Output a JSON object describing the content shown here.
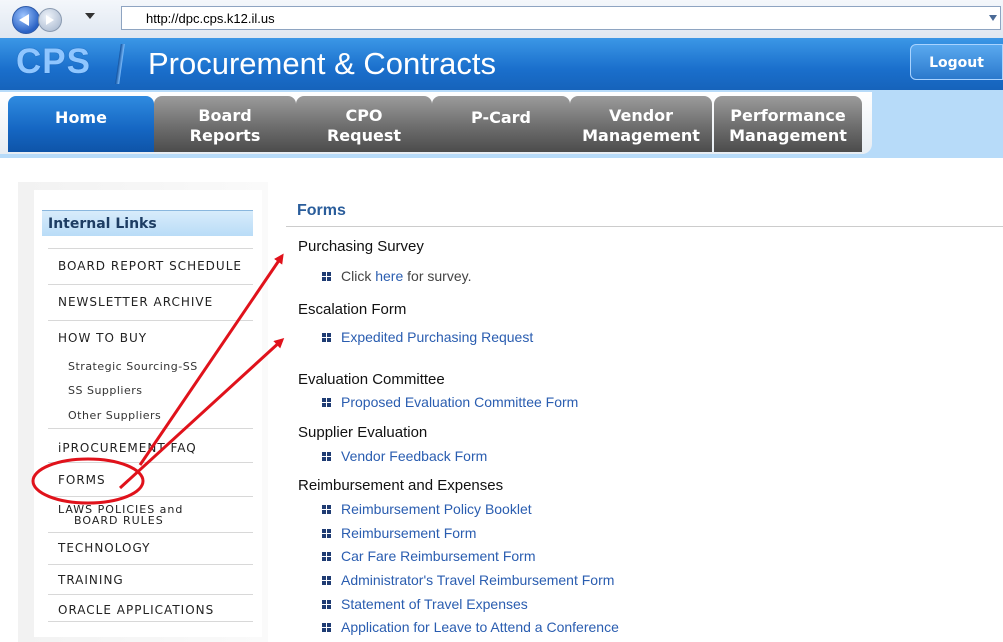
{
  "browser": {
    "url": "http://dpc.cps.k12.il.us"
  },
  "header": {
    "logo": "CPS",
    "title": "Procurement & Contracts",
    "logout_label": "Logout",
    "accent": "#1a6fcc"
  },
  "tabs": [
    {
      "line1": "Home",
      "line2": ""
    },
    {
      "line1": "Board",
      "line2": "Reports"
    },
    {
      "line1": "CPO",
      "line2": "Request"
    },
    {
      "line1": "P-Card",
      "line2": ""
    },
    {
      "line1": "Vendor",
      "line2": "Management"
    },
    {
      "line1": "Performance",
      "line2": "Management"
    }
  ],
  "sidebar": {
    "heading": "Internal Links",
    "items": [
      "BOARD REPORT SCHEDULE",
      "NEWSLETTER ARCHIVE",
      "HOW TO BUY",
      "iPROCUREMENT FAQ",
      "FORMS",
      "LAWS POLICIES and",
      "BOARD RULES",
      "TECHNOLOGY",
      "TRAINING",
      "ORACLE APPLICATIONS"
    ],
    "subitems": [
      "Strategic Sourcing-SS",
      "SS Suppliers",
      "Other Suppliers"
    ]
  },
  "content": {
    "title": "Forms",
    "sections": {
      "purchasing_survey": {
        "title": "Purchasing Survey",
        "prefix": "Click",
        "link": "here",
        "suffix": "for survey."
      },
      "escalation": {
        "title": "Escalation Form",
        "links": [
          "Expedited Purchasing Request"
        ]
      },
      "evaluation_committee": {
        "title": "Evaluation Committee",
        "links": [
          "Proposed Evaluation Committee Form"
        ]
      },
      "supplier_evaluation": {
        "title": "Supplier Evaluation",
        "links": [
          "Vendor Feedback Form"
        ]
      },
      "reimbursement": {
        "title": "Reimbursement and Expenses",
        "links": [
          "Reimbursement Policy Booklet",
          "Reimbursement Form",
          "Car Fare Reimbursement Form",
          "Administrator's Travel Reimbursement Form",
          "Statement of Travel Expenses",
          "Application for Leave to Attend a Conference"
        ]
      }
    }
  },
  "annotation": {
    "color": "#e0121b"
  }
}
